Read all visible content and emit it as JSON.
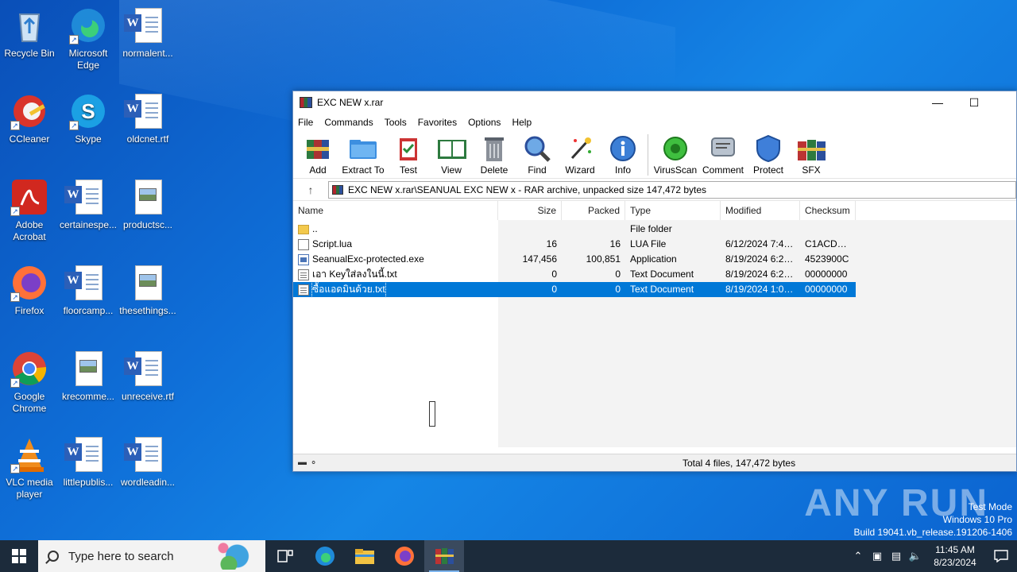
{
  "desktop": {
    "icons": [
      {
        "label": "Recycle Bin",
        "icon": "recycle-bin-icon"
      },
      {
        "label": "Microsoft Edge",
        "icon": "edge-icon"
      },
      {
        "label": "normalent...",
        "icon": "word-doc-icon"
      },
      {
        "label": "CCleaner",
        "icon": "ccleaner-icon"
      },
      {
        "label": "Skype",
        "icon": "skype-icon"
      },
      {
        "label": "oldcnet.rtf",
        "icon": "word-doc-icon"
      },
      {
        "label": "Adobe Acrobat",
        "icon": "acrobat-icon"
      },
      {
        "label": "certainespe...",
        "icon": "word-doc-icon"
      },
      {
        "label": "productsc...",
        "icon": "image-doc-icon"
      },
      {
        "label": "Firefox",
        "icon": "firefox-icon"
      },
      {
        "label": "floorcamp...",
        "icon": "word-doc-icon"
      },
      {
        "label": "thesethings...",
        "icon": "image-doc-icon"
      },
      {
        "label": "Google Chrome",
        "icon": "chrome-icon"
      },
      {
        "label": "krecomme...",
        "icon": "image-doc-icon"
      },
      {
        "label": "unreceive.rtf",
        "icon": "word-doc-icon"
      },
      {
        "label": "VLC media player",
        "icon": "vlc-icon"
      },
      {
        "label": "littlepublis...",
        "icon": "word-doc-icon"
      },
      {
        "label": "wordleadin...",
        "icon": "word-doc-icon"
      }
    ]
  },
  "window": {
    "title": "EXC NEW x.rar",
    "menu": [
      "File",
      "Commands",
      "Tools",
      "Favorites",
      "Options",
      "Help"
    ],
    "toolbar": [
      "Add",
      "Extract To",
      "Test",
      "View",
      "Delete",
      "Find",
      "Wizard",
      "Info",
      "VirusScan",
      "Comment",
      "Protect",
      "SFX"
    ],
    "address": "EXC NEW x.rar\\SEANUAL EXC NEW x - RAR archive, unpacked size 147,472 bytes",
    "columns": {
      "name": "Name",
      "size": "Size",
      "packed": "Packed",
      "type": "Type",
      "modified": "Modified",
      "checksum": "Checksum"
    },
    "rows": [
      {
        "name": "..",
        "size": "",
        "packed": "",
        "type": "File folder",
        "modified": "",
        "checksum": "",
        "icon": "folder"
      },
      {
        "name": "Script.lua",
        "size": "16",
        "packed": "16",
        "type": "LUA File",
        "modified": "6/12/2024 7:47 ...",
        "checksum": "C1ACDB...",
        "icon": "file"
      },
      {
        "name": "SeanualExc-protected.exe",
        "size": "147,456",
        "packed": "100,851",
        "type": "Application",
        "modified": "8/19/2024 6:22 ...",
        "checksum": "4523900C",
        "icon": "exe"
      },
      {
        "name": "เอา Keyใส่ลงในนี้.txt",
        "size": "0",
        "packed": "0",
        "type": "Text Document",
        "modified": "8/19/2024 6:27 ...",
        "checksum": "00000000",
        "icon": "txt"
      },
      {
        "name": "ซื้อแอดมินด้วย.txt",
        "size": "0",
        "packed": "0",
        "type": "Text Document",
        "modified": "8/19/2024 1:05 ...",
        "checksum": "00000000",
        "icon": "txt",
        "selected": true
      }
    ],
    "status": "Total 4 files, 147,472 bytes"
  },
  "watermark": "ANY RUN",
  "sysinfo": {
    "line1": "Test Mode",
    "line2": "Windows 10 Pro",
    "line3": "Build 19041.vb_release.191206-1406"
  },
  "taskbar": {
    "search_placeholder": "Type here to search",
    "time": "11:45 AM",
    "date": "8/23/2024"
  }
}
